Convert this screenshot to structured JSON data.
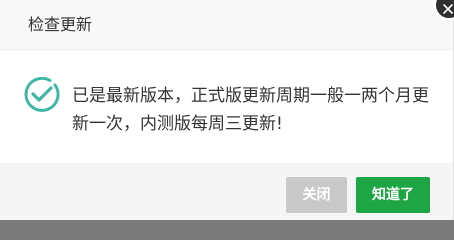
{
  "dialog": {
    "title": "检查更新",
    "message": "已是最新版本，正式版更新周期一般一两个月更新一次，内测版每周三更新!",
    "icons": {
      "status": "check-circle-icon",
      "close": "close-icon"
    },
    "buttons": {
      "close_label": "关闭",
      "ok_label": "知道了"
    },
    "colors": {
      "accent": "#1ea644",
      "icon": "#3cb8a5",
      "disabled_button": "#c9c9c9"
    }
  }
}
